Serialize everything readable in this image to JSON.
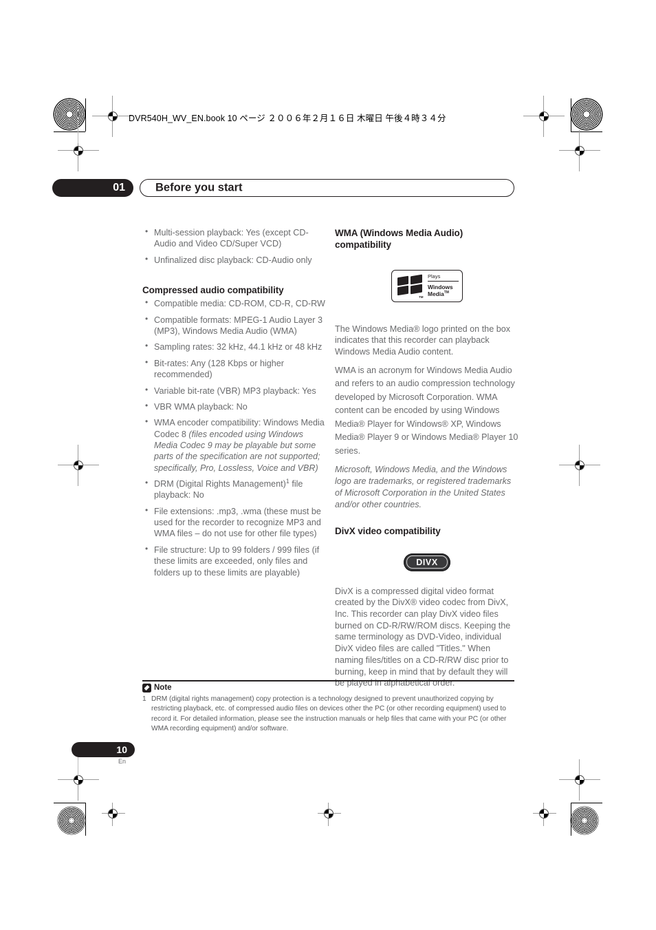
{
  "document": {
    "book_header": "DVR540H_WV_EN.book 10 ページ ２００６年２月１６日 木曜日 午後４時３４分",
    "chapter_number": "01",
    "chapter_title": "Before you start",
    "page_number": "10",
    "language_code": "En"
  },
  "left_column": {
    "intro_bullets": [
      "Multi-session playback: Yes (except CD-Audio and Video CD/Super VCD)",
      "Unfinalized disc playback: CD-Audio only"
    ],
    "section_heading": "Compressed audio compatibility",
    "bullets": [
      {
        "text": "Compatible media: CD-ROM, CD-R, CD-RW"
      },
      {
        "text": "Compatible formats: MPEG-1 Audio Layer 3 (MP3), Windows Media Audio (WMA)"
      },
      {
        "text": "Sampling rates: 32 kHz, 44.1 kHz or 48 kHz"
      },
      {
        "text": "Bit-rates: Any (128 Kbps or higher recommended)"
      },
      {
        "text": "Variable bit-rate (VBR) MP3 playback: Yes"
      },
      {
        "text": "VBR WMA playback: No"
      },
      {
        "text": "WMA encoder compatibility: Windows Media Codec 8 ",
        "italic": "(files encoded using Windows Media Codec 9 may be playable but some parts of the specification are not supported; specifically, Pro, Lossless, Voice and VBR)"
      },
      {
        "text_pre": "DRM (Digital Rights Management)",
        "sup": "1",
        "text_post": " file playback: No"
      },
      {
        "text": "File extensions: .mp3, .wma (these must be used for the recorder to recognize MP3 and WMA files – do not use for other file types)"
      },
      {
        "text": "File structure: Up to 99 folders / 999 files (if these limits are exceeded, only files and folders up to these limits are playable)"
      }
    ]
  },
  "right_column": {
    "wma_heading": "WMA (Windows Media Audio) compatibility",
    "wma_logo": {
      "plays_label": "Plays",
      "brand_line1": "Windows",
      "brand_line2": "Media",
      "tm_small": "TM",
      "tm_brand": "TM"
    },
    "wma_paragraphs": [
      "The Windows Media® logo printed on the box indicates that this recorder can playback Windows Media Audio content.",
      "WMA is an acronym for Windows Media Audio and refers to an audio compression technology developed by Microsoft Corporation. WMA content can be encoded by using Windows Media® Player for Windows® XP, Windows Media® Player 9 or Windows Media® Player 10 series."
    ],
    "wma_trademark_note": "Microsoft, Windows Media, and the Windows logo are trademarks, or registered trademarks of Microsoft Corporation in the United States and/or other countries.",
    "divx_heading": "DivX video compatibility",
    "divx_logo_text": "DIVX",
    "divx_paragraph": "DivX is a compressed digital video format created by the DivX® video codec from DivX, Inc. This recorder can play DivX video files burned on CD-R/RW/ROM discs. Keeping the same terminology as DVD-Video, individual DivX video files are called \"Titles.\" When naming files/titles on a CD-R/RW disc prior to burning, keep in mind that by default they will be played in alphabetical order."
  },
  "note": {
    "label": "Note",
    "footnote_number": "1",
    "footnote_text": "DRM (digital rights management) copy protection is a technology designed to prevent unauthorized copying by restricting playback, etc. of compressed audio files on devices other the PC (or other recording equipment) used to record it. For detailed information, please see the instruction manuals or help files that came with your PC (or other WMA recording equipment) and/or software."
  },
  "colors": {
    "ink_black": "#231f20",
    "body_gray": "#6a6b6d",
    "paper": "#ffffff"
  }
}
